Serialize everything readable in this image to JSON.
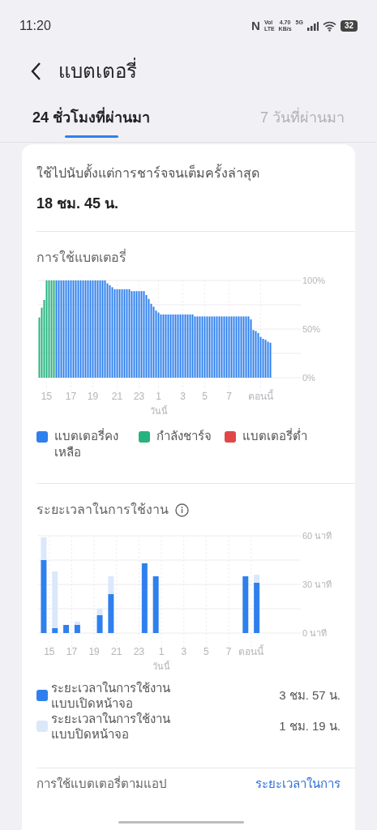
{
  "status_bar": {
    "time": "11:20",
    "nfc": "N",
    "volte": [
      "Vol",
      "LTE"
    ],
    "speed": [
      "4.70",
      "KB/s"
    ],
    "network": "5G",
    "battery": "32"
  },
  "header": {
    "title": "แบตเตอรี่"
  },
  "tabs": [
    {
      "label": "24 ชั่วโมงที่ผ่านมา",
      "selected": true
    },
    {
      "label": "7 วันที่ผ่านมา",
      "selected": false
    }
  ],
  "since_charge": {
    "label": "ใช้ไปนับตั้งแต่การชาร์จจนเต็มครั้งล่าสุด",
    "value": "18 ชม. 45 น."
  },
  "battery_usage": {
    "title": "การใช้แบตเตอรี่",
    "today_label": "วันนี้",
    "chart_data": {
      "type": "bar",
      "grid": true,
      "categories": [
        null,
        null,
        null,
        "15",
        null,
        null,
        null,
        null,
        null,
        null,
        null,
        null,
        null,
        "17",
        null,
        null,
        null,
        null,
        null,
        null,
        null,
        null,
        "19",
        null,
        null,
        null,
        null,
        null,
        null,
        null,
        null,
        null,
        "21",
        null,
        null,
        null,
        null,
        null,
        null,
        null,
        null,
        "23",
        null,
        null,
        null,
        null,
        null,
        null,
        null,
        "1",
        null,
        null,
        null,
        null,
        null,
        null,
        null,
        null,
        null,
        "3",
        null,
        null,
        null,
        null,
        null,
        null,
        null,
        null,
        "5",
        null,
        null,
        null,
        null,
        null,
        null,
        null,
        null,
        null,
        "7",
        null,
        null,
        null,
        null,
        null,
        null,
        null,
        null,
        null,
        null,
        null,
        null,
        "ตอนนี้",
        null,
        null,
        null,
        null
      ],
      "ylim": [
        0,
        100
      ],
      "yticks": [
        {
          "value": 0,
          "label": "0%"
        },
        {
          "value": 50,
          "label": "50%"
        },
        {
          "value": 100,
          "label": "100%"
        }
      ],
      "series": [
        {
          "name": "แบตเตอรี่คงเหลือ",
          "color": "#2f80ed",
          "values": [
            null,
            null,
            null,
            null,
            null,
            null,
            null,
            100,
            100,
            100,
            100,
            100,
            100,
            100,
            100,
            100,
            100,
            100,
            100,
            100,
            100,
            100,
            100,
            100,
            100,
            100,
            100,
            100,
            97,
            95,
            93,
            91,
            91,
            91,
            91,
            91,
            91,
            91,
            89,
            89,
            89,
            89,
            89,
            89,
            85,
            81,
            76,
            73,
            69,
            67,
            65,
            65,
            65,
            65,
            65,
            65,
            65,
            65,
            65,
            65,
            65,
            65,
            65,
            65,
            63,
            63,
            63,
            63,
            63,
            63,
            63,
            63,
            63,
            63,
            63,
            63,
            63,
            63,
            63,
            63,
            63,
            63,
            63,
            63,
            63,
            63,
            63,
            60,
            49,
            48,
            46,
            42,
            40,
            39,
            37,
            36
          ]
        },
        {
          "name": "กำลังชาร์จ",
          "color": "#27b37f",
          "values": [
            62,
            72,
            80,
            100,
            100,
            100,
            100,
            null,
            null,
            null,
            null,
            null,
            null,
            null,
            null,
            null,
            null,
            null,
            null,
            null,
            null,
            null,
            null,
            null,
            null,
            null,
            null,
            null,
            null,
            null,
            null,
            null,
            null,
            null,
            null,
            null,
            null,
            null,
            null,
            null,
            null,
            null,
            null,
            null,
            null,
            null,
            null,
            null,
            null,
            null,
            null,
            null,
            null,
            null,
            null,
            null,
            null,
            null,
            null,
            null,
            null,
            null,
            null,
            null,
            null,
            null,
            null,
            null,
            null,
            null,
            null,
            null,
            null,
            null,
            null,
            null,
            null,
            null,
            null,
            null,
            null,
            null,
            null,
            null,
            null,
            null,
            null,
            null,
            null,
            null,
            null,
            null,
            null,
            null,
            null,
            null
          ]
        },
        {
          "name": "แบตเตอรี่ต่ำ",
          "color": "#e04848",
          "values": [
            null,
            null,
            null,
            null,
            null,
            null,
            null,
            null,
            null,
            null,
            null,
            null,
            null,
            null,
            null,
            null,
            null,
            null,
            null,
            null,
            null,
            null,
            null,
            null,
            null,
            null,
            null,
            null,
            null,
            null,
            null,
            null,
            null,
            null,
            null,
            null,
            null,
            null,
            null,
            null,
            null,
            null,
            null,
            null,
            null,
            null,
            null,
            null,
            null,
            null,
            null,
            null,
            null,
            null,
            null,
            null,
            null,
            null,
            null,
            null,
            null,
            null,
            null,
            null,
            null,
            null,
            null,
            null,
            null,
            null,
            null,
            null,
            null,
            null,
            null,
            null,
            null,
            null,
            null,
            null,
            null,
            null,
            null,
            null,
            null,
            null,
            null,
            null,
            null,
            null,
            null,
            null,
            null,
            null,
            null,
            null
          ]
        }
      ]
    }
  },
  "screen_time": {
    "title": "ระยะเวลาในการใช้งาน",
    "today_label": "วันนี้",
    "chart_data": {
      "type": "bar",
      "stacked": true,
      "grid": true,
      "categories": [
        "15",
        null,
        "17",
        null,
        "19",
        null,
        "21",
        null,
        "23",
        null,
        "1",
        null,
        "3",
        null,
        "5",
        null,
        "7",
        null,
        "ตอนนี้",
        null
      ],
      "ylim": [
        0,
        60
      ],
      "yticks": [
        {
          "value": 0,
          "label": "0 นาที"
        },
        {
          "value": 30,
          "label": "30 นาที"
        },
        {
          "value": 60,
          "label": "60 นาที"
        }
      ],
      "series": [
        {
          "name": "ระยะเวลาในการใช้งานแบบเปิดหน้าจอ",
          "color": "#2f80ed",
          "values": [
            45,
            3,
            5,
            5,
            0,
            11,
            24,
            0,
            0,
            43,
            35,
            0,
            0,
            0,
            0,
            0,
            0,
            0,
            35,
            31
          ]
        },
        {
          "name": "ระยะเวลาในการใช้งานแบบปิดหน้าจอ",
          "color": "#dbe8fb",
          "values": [
            14,
            35,
            0,
            2,
            0,
            4,
            11,
            0,
            0,
            0,
            0,
            0,
            0,
            0,
            0,
            0,
            0,
            0,
            0,
            5
          ]
        }
      ]
    },
    "legend_values": [
      "3 ชม. 57 น.",
      "1 ชม. 19 น."
    ]
  },
  "app_usage": {
    "title": "การใช้แบตเตอรี่ตามแอป",
    "link": "ระยะเวลาในการ"
  }
}
